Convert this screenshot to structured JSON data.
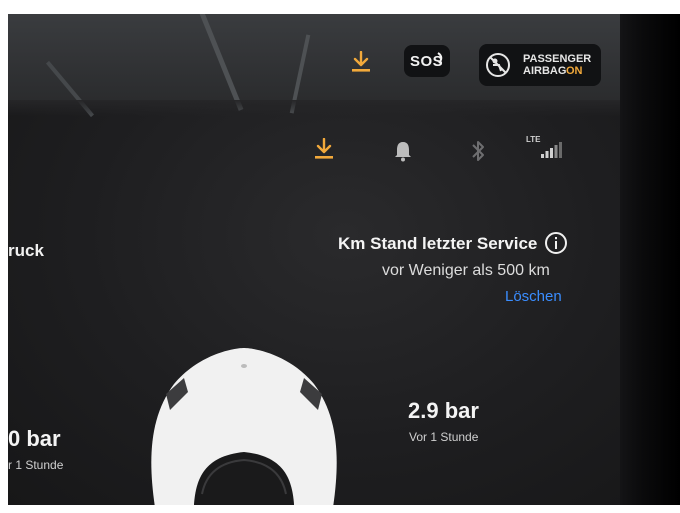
{
  "status_bar": {
    "sos_label": "SOS",
    "airbag_line1": "PASSENGER",
    "airbag_line2": "AIRBAG",
    "airbag_state": "ON",
    "lte_label": "LTE",
    "accent_color": "#f2a93b",
    "icons": [
      "download-icon",
      "sos-icon",
      "airbag-icon",
      "bell-icon",
      "bluetooth-icon",
      "signal-icon"
    ]
  },
  "left_card": {
    "truncated_label": "ruck"
  },
  "service": {
    "title": "Km Stand letzter Service",
    "subtitle": "vor Weniger als 500 km",
    "reset_label": "Löschen",
    "link_color": "#3a8dff"
  },
  "tires": {
    "left_value": "0 bar",
    "left_time": "r 1 Stunde",
    "right_value": "2.9 bar",
    "right_time": "Vor 1 Stunde"
  }
}
